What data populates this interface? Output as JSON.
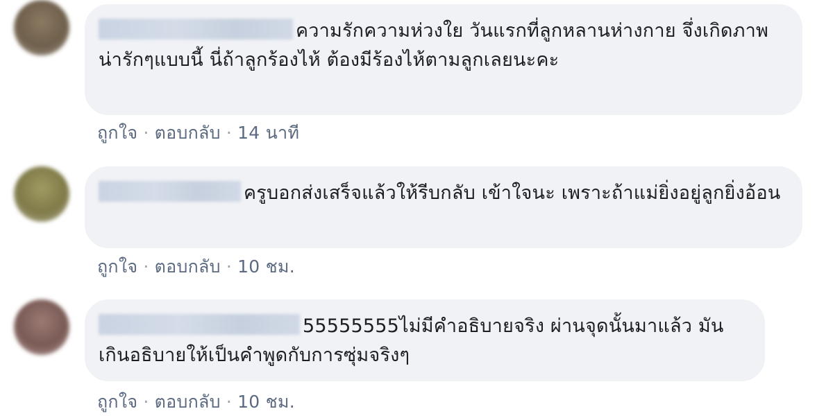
{
  "comments": [
    {
      "text": "ความรักความห่วงใย วันแรกที่ลูกหลานห่างกาย จึ่งเกิดภาพน่ารักๆแบบนี้ นี่ถ้าลูกร้องไห้ ต้องมีร้องไห้ตามลูกเลยนะคะ",
      "like_label": "ถูกใจ",
      "reply_label": "ตอบกลับ",
      "time": "14 นาที",
      "avatar_color": "#7a6a55"
    },
    {
      "text": "ครูบอกส่งเสร็จแล้วให้รีบกลับ เข้าใจนะ เพราะถ้าแม่ยิ่งอยู่ลูกยิ่งอ้อน",
      "like_label": "ถูกใจ",
      "reply_label": "ตอบกลับ",
      "time": "10 ชม.",
      "avatar_color": "#8f8a52"
    },
    {
      "text": "55555555ไม่มีคำอธิบายจริง ผ่านจุดนั้นมาแล้ว มันเกินอธิบายให้เป็นคำพูดกับการซุ่มจริงๆ",
      "like_label": "ถูกใจ",
      "reply_label": "ตอบกลับ",
      "time": "10 ชม.",
      "avatar_color": "#8a6a66"
    }
  ],
  "separator": "·"
}
